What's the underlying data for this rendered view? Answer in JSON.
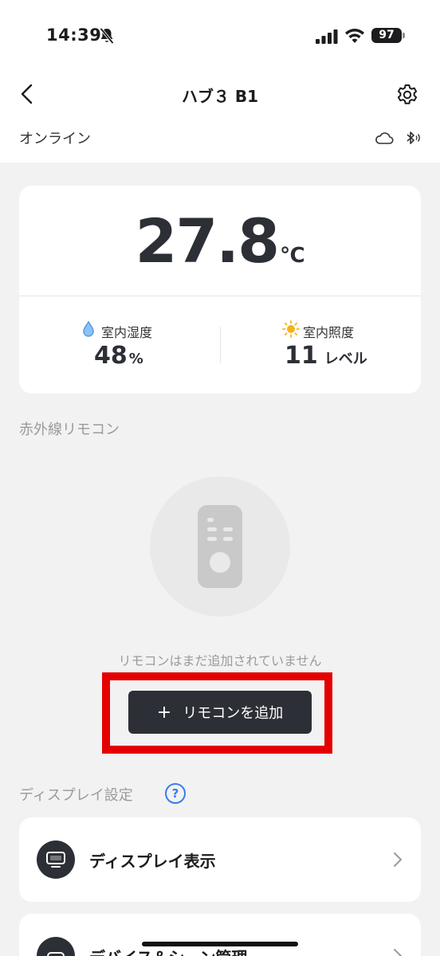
{
  "status_bar": {
    "time": "14:39",
    "battery": "97",
    "icons": [
      "bell-slash-icon",
      "signal-icon",
      "wifi-icon",
      "battery-icon"
    ]
  },
  "header": {
    "title": "ハブ３ B1",
    "back_icon": "chevron-left-icon",
    "settings_icon": "gear-icon"
  },
  "connection": {
    "status": "オンライン",
    "icons": [
      "cloud-icon",
      "bluetooth-icon"
    ]
  },
  "sensor_card": {
    "temperature": "27.8",
    "temperature_unit": "℃",
    "humidity": {
      "label": "室内湿度",
      "value": "48",
      "unit": "%",
      "icon": "water-drop-icon"
    },
    "illuminance": {
      "label": "室内照度",
      "value": "11",
      "unit": "レベル",
      "icon": "sun-icon"
    }
  },
  "ir_remote": {
    "section_title": "赤外線リモコン",
    "empty_message": "リモコンはまだ追加されていません",
    "add_button_label": "リモコンを追加",
    "add_button_icon": "plus-icon",
    "placeholder_icon": "remote-control-icon"
  },
  "display_settings": {
    "section_title": "ディスプレイ設定",
    "help_label": "?",
    "items": [
      {
        "label": "ディスプレイ表示",
        "icon": "monitor-icon"
      },
      {
        "label": "デバイス＆シーン管理",
        "icon": "device-icon"
      }
    ]
  },
  "colors": {
    "accent_dark": "#2d2f36",
    "highlight": "#e40000",
    "help_blue": "#3a7bf0",
    "sun": "#f6b21b",
    "drop": "#5b9be6"
  }
}
